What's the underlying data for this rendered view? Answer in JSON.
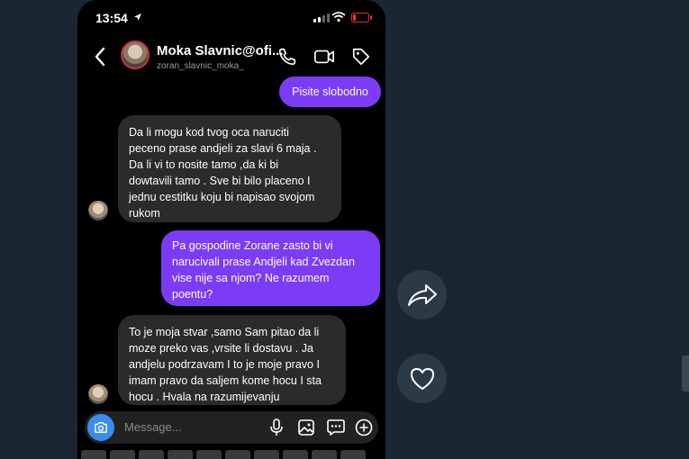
{
  "status_bar": {
    "time": "13:54"
  },
  "header": {
    "name": "Moka Slavnic@ofi...",
    "handle": "zoran_slavnic_moka_"
  },
  "messages": [
    {
      "direction": "outgoing",
      "lines": [
        "Pisite slobodno"
      ]
    },
    {
      "direction": "incoming",
      "lines": [
        "Da li mogu kod tvog oca naruciti",
        "peceno prase andjeli za slavi 6 maja .",
        "Da li vi to nosite tamo ,da ki bi",
        "dowtavili tamo . Sve bi bilo placeno I",
        "jednu cestitku koju bi napisao svojom",
        "rukom"
      ]
    },
    {
      "direction": "outgoing",
      "lines": [
        "Pa gospodine Zorane zasto bi vi",
        "narucivali prase Andjeli kad Zvezdan",
        "vise nije sa njom? Ne razumem",
        "poentu?"
      ]
    },
    {
      "direction": "incoming",
      "lines": [
        "To je moja stvar ,samo Sam pitao da li",
        "moze preko vas ,vrsite li dostavu . Ja",
        "andjelu podrzavam I to je moje pravo I",
        "imam pravo da saljem kome hocu I sta",
        "hocu . Hvala na razumijevanju"
      ]
    }
  ],
  "composer": {
    "placeholder": "Message..."
  },
  "colors": {
    "outgoing_bubble": "#7c3bf5",
    "incoming_bubble": "#2b2b2b",
    "page_bg": "#1a2732",
    "camera_button": "#3a8cf0"
  },
  "icons": [
    "back-icon",
    "phone-icon",
    "video-icon",
    "tag-icon",
    "camera-icon",
    "mic-icon",
    "gallery-icon",
    "sticker-icon",
    "plus-icon",
    "share-icon",
    "heart-icon"
  ]
}
